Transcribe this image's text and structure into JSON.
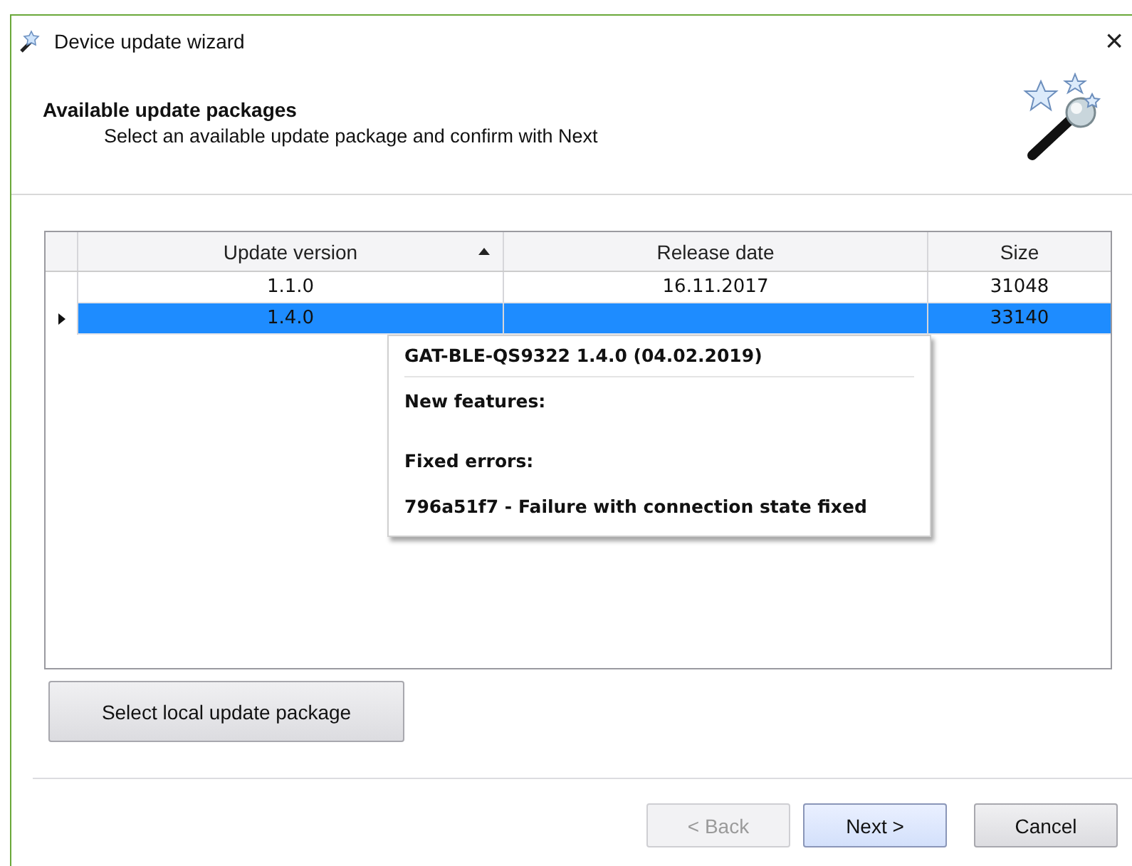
{
  "window": {
    "title": "Device update wizard",
    "close": "×"
  },
  "header": {
    "title": "Available update packages",
    "subtitle": "Select an available update package and confirm with Next"
  },
  "table": {
    "columns": [
      {
        "label": "Update version",
        "sorted": true
      },
      {
        "label": "Release date",
        "sorted": false
      },
      {
        "label": "Size",
        "sorted": false
      }
    ],
    "rows": [
      {
        "selected": false,
        "cells": [
          "1.1.0",
          "16.11.2017",
          "31048"
        ]
      },
      {
        "selected": true,
        "cells": [
          "1.4.0",
          null,
          "33140"
        ]
      }
    ]
  },
  "tooltip": {
    "title": "GAT-BLE-QS9322 1.4.0 (04.02.2019)",
    "lines": [
      {
        "kind": "section",
        "text": "New features:"
      },
      {
        "kind": "section",
        "text": "Fixed errors:"
      },
      {
        "kind": "entry",
        "text": "796a51f7 - Failure with connection state fixed"
      }
    ]
  },
  "local_button": {
    "label": "Select local update package"
  },
  "buttons": [
    {
      "label": "< Back",
      "disabled": true,
      "default": false
    },
    {
      "label": "Next >",
      "disabled": false,
      "default": true
    },
    {
      "label": "Cancel",
      "disabled": false,
      "default": false
    }
  ]
}
